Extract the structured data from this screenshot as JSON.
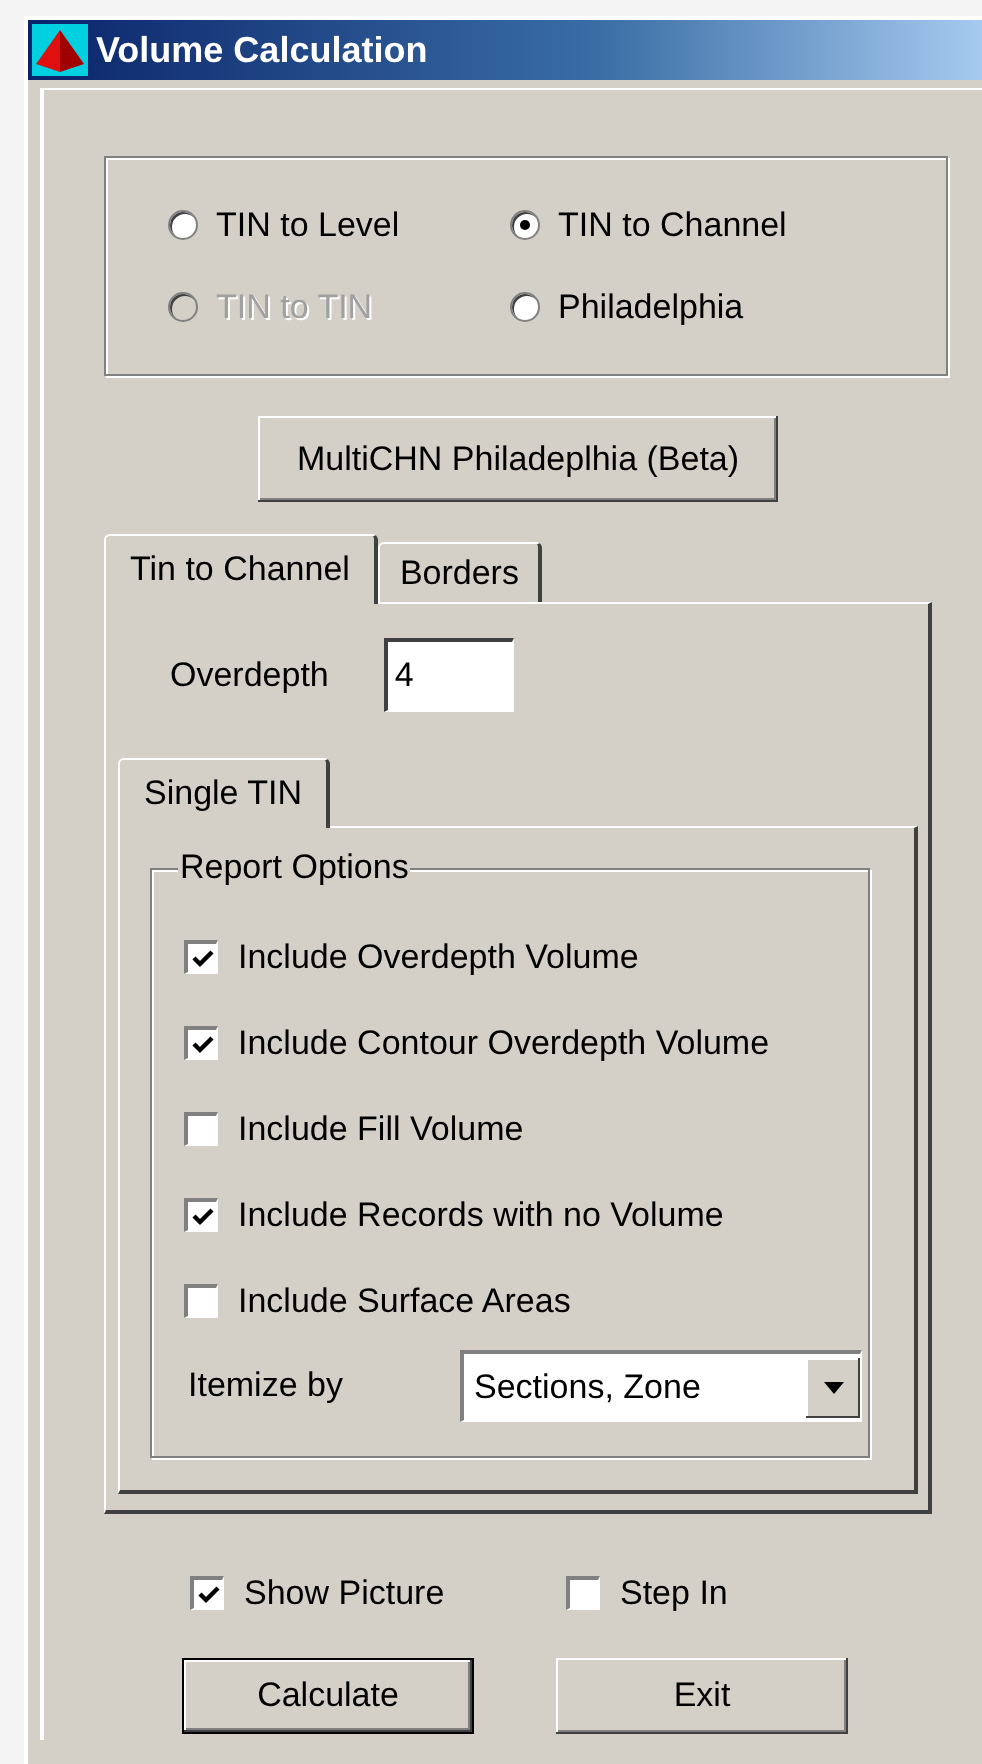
{
  "window": {
    "title": "Volume Calculation"
  },
  "modes": [
    {
      "label": "TIN to Level",
      "selected": false,
      "disabled": false
    },
    {
      "label": "TIN to Channel",
      "selected": true,
      "disabled": false
    },
    {
      "label": "TIN to TIN",
      "selected": false,
      "disabled": true
    },
    {
      "label": "Philadelphia",
      "selected": false,
      "disabled": false
    }
  ],
  "multi_button": "MultiCHN Philadeplhia (Beta)",
  "tabs": [
    {
      "label": "Tin to Channel",
      "selected": true
    },
    {
      "label": "Borders",
      "selected": false
    }
  ],
  "overdepth": {
    "label": "Overdepth",
    "value": "4"
  },
  "inner_tabs": [
    {
      "label": "Single TIN",
      "selected": true
    }
  ],
  "report_options": {
    "title": "Report Options",
    "items": [
      {
        "label": "Include Overdepth Volume",
        "checked": true
      },
      {
        "label": "Include Contour Overdepth Volume",
        "checked": true
      },
      {
        "label": "Include Fill Volume",
        "checked": false
      },
      {
        "label": "Include Records with no Volume",
        "checked": true
      },
      {
        "label": "Include Surface Areas",
        "checked": false
      }
    ],
    "itemize": {
      "label": "Itemize by",
      "value": "Sections, Zone"
    }
  },
  "options": [
    {
      "label": "Show Picture",
      "checked": true
    },
    {
      "label": "Step In",
      "checked": false
    }
  ],
  "buttons": [
    {
      "label": "Calculate",
      "default": true
    },
    {
      "label": "Exit",
      "default": false
    }
  ]
}
